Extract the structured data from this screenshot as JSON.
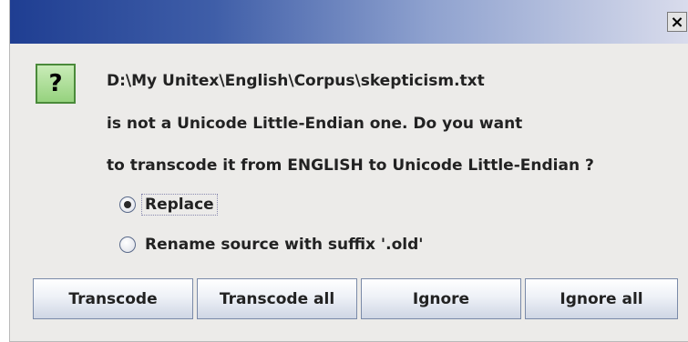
{
  "titlebar": {
    "close_glyph": "×"
  },
  "icon": {
    "name": "question-icon",
    "glyph": "?"
  },
  "message": {
    "line1": "D:\\My Unitex\\English\\Corpus\\skepticism.txt",
    "line2": "is not a Unicode Little-Endian one. Do you want",
    "line3": "to transcode it from ENGLISH to Unicode Little-Endian ?"
  },
  "options": [
    {
      "label": "Replace",
      "selected": true
    },
    {
      "label": "Rename source with suffix '.old'",
      "selected": false
    }
  ],
  "buttons": {
    "transcode": "Transcode",
    "transcode_all": "Transcode all",
    "ignore": "Ignore",
    "ignore_all": "Ignore all"
  },
  "colors": {
    "titlebar_start": "#1f3e92",
    "titlebar_end": "#d9dcec",
    "icon_bg": "#96d27e"
  }
}
